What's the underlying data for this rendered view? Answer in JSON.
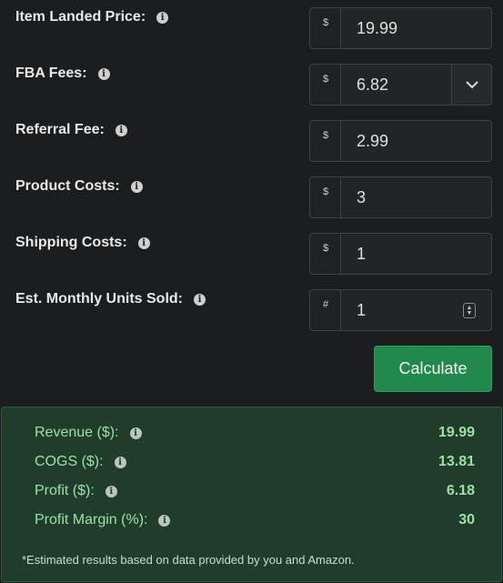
{
  "fields": [
    {
      "label": "Item Landed Price:",
      "addon": "$",
      "value": "19.99"
    },
    {
      "label": "FBA Fees:",
      "addon": "$",
      "value": "6.82"
    },
    {
      "label": "Referral Fee:",
      "addon": "$",
      "value": "2.99"
    },
    {
      "label": "Product Costs:",
      "addon": "$",
      "value": "3"
    },
    {
      "label": "Shipping Costs:",
      "addon": "$",
      "value": "1"
    },
    {
      "label": "Est. Monthly Units Sold:",
      "addon": "#",
      "value": "1"
    }
  ],
  "calculate_label": "Calculate",
  "results": [
    {
      "label": "Revenue ($):",
      "value": "19.99"
    },
    {
      "label": "COGS ($):",
      "value": "13.81"
    },
    {
      "label": "Profit ($):",
      "value": "6.18"
    },
    {
      "label": "Profit Margin (%):",
      "value": "30"
    }
  ],
  "footnote": "*Estimated results based on data provided by you and Amazon.",
  "icons": {
    "info": "info-icon",
    "dropdown": "chevron-down-icon",
    "stepper": "stepper-icon"
  },
  "colors": {
    "accent": "#1f8a4c",
    "results_bg": "#203d2b",
    "results_text": "#9ce0a8"
  }
}
